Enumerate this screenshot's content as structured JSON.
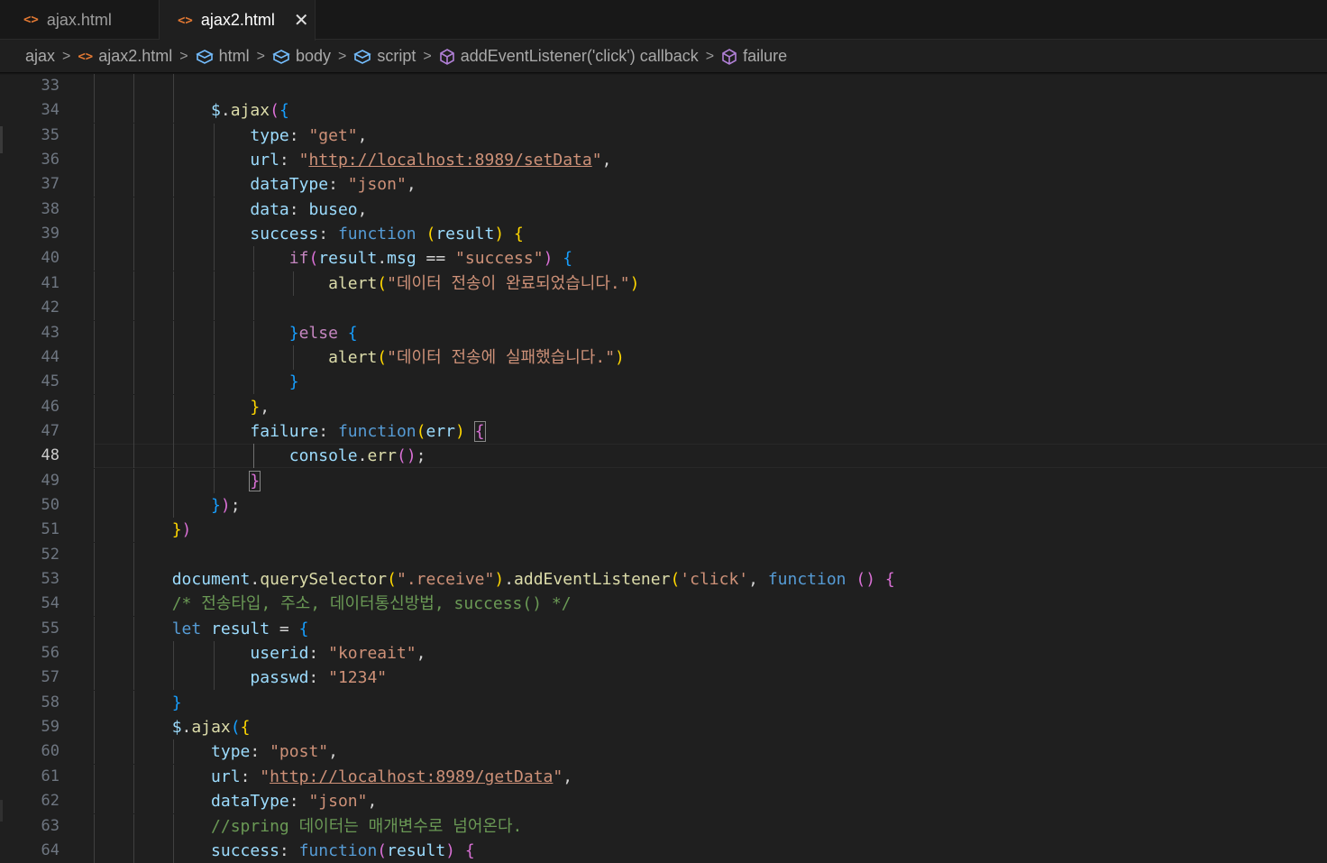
{
  "tabs": [
    {
      "label": "ajax.html",
      "icon": "html-file-icon",
      "active": false
    },
    {
      "label": "ajax2.html",
      "icon": "html-file-icon",
      "active": true
    }
  ],
  "breadcrumbs": [
    {
      "label": "ajax",
      "icon": ""
    },
    {
      "label": "ajax2.html",
      "icon": "html-file-icon"
    },
    {
      "label": "html",
      "icon": "element-icon"
    },
    {
      "label": "body",
      "icon": "element-icon"
    },
    {
      "label": "script",
      "icon": "element-icon"
    },
    {
      "label": "addEventListener('click') callback",
      "icon": "method-icon"
    },
    {
      "label": "failure",
      "icon": "method-icon"
    }
  ],
  "editor": {
    "current_line": "48",
    "lines": [
      {
        "n": "33",
        "tokens": []
      },
      {
        "n": "34",
        "tokens": [
          [
            "            ",
            "plain"
          ],
          [
            "$",
            "var"
          ],
          [
            ".",
            "plain"
          ],
          [
            "ajax",
            "func"
          ],
          [
            "(",
            "b2"
          ],
          [
            "{",
            "b3"
          ]
        ]
      },
      {
        "n": "35",
        "tokens": [
          [
            "                ",
            "plain"
          ],
          [
            "type",
            "var"
          ],
          [
            ": ",
            "plain"
          ],
          [
            "\"get\"",
            "str"
          ],
          [
            ",",
            "plain"
          ]
        ]
      },
      {
        "n": "36",
        "tokens": [
          [
            "                ",
            "plain"
          ],
          [
            "url",
            "var"
          ],
          [
            ": ",
            "plain"
          ],
          [
            "\"",
            "str"
          ],
          [
            "http://localhost:8989/setData",
            "url"
          ],
          [
            "\"",
            "str"
          ],
          [
            ",",
            "plain"
          ]
        ]
      },
      {
        "n": "37",
        "tokens": [
          [
            "                ",
            "plain"
          ],
          [
            "dataType",
            "var"
          ],
          [
            ": ",
            "plain"
          ],
          [
            "\"json\"",
            "str"
          ],
          [
            ",",
            "plain"
          ]
        ]
      },
      {
        "n": "38",
        "tokens": [
          [
            "                ",
            "plain"
          ],
          [
            "data",
            "var"
          ],
          [
            ": ",
            "plain"
          ],
          [
            "buseo",
            "var"
          ],
          [
            ",",
            "plain"
          ]
        ]
      },
      {
        "n": "39",
        "tokens": [
          [
            "                ",
            "plain"
          ],
          [
            "success",
            "var"
          ],
          [
            ": ",
            "plain"
          ],
          [
            "function",
            "kw"
          ],
          [
            " ",
            "plain"
          ],
          [
            "(",
            "b1"
          ],
          [
            "result",
            "var"
          ],
          [
            ")",
            "b1"
          ],
          [
            " ",
            "plain"
          ],
          [
            "{",
            "b1"
          ]
        ]
      },
      {
        "n": "40",
        "tokens": [
          [
            "                    ",
            "plain"
          ],
          [
            "if",
            "ctl"
          ],
          [
            "(",
            "b2"
          ],
          [
            "result",
            "var"
          ],
          [
            ".",
            "plain"
          ],
          [
            "msg",
            "var"
          ],
          [
            " == ",
            "plain"
          ],
          [
            "\"success\"",
            "str"
          ],
          [
            ")",
            "b2"
          ],
          [
            " ",
            "plain"
          ],
          [
            "{",
            "b3"
          ]
        ]
      },
      {
        "n": "41",
        "tokens": [
          [
            "                        ",
            "plain"
          ],
          [
            "alert",
            "func"
          ],
          [
            "(",
            "b1"
          ],
          [
            "\"데이터 전송이 완료되었습니다.\"",
            "str"
          ],
          [
            ")",
            "b1"
          ]
        ]
      },
      {
        "n": "42",
        "tokens": []
      },
      {
        "n": "43",
        "tokens": [
          [
            "                    ",
            "plain"
          ],
          [
            "}",
            "b3"
          ],
          [
            "else",
            "ctl"
          ],
          [
            " ",
            "plain"
          ],
          [
            "{",
            "b3"
          ]
        ]
      },
      {
        "n": "44",
        "tokens": [
          [
            "                        ",
            "plain"
          ],
          [
            "alert",
            "func"
          ],
          [
            "(",
            "b1"
          ],
          [
            "\"데이터 전송에 실패했습니다.\"",
            "str"
          ],
          [
            ")",
            "b1"
          ]
        ]
      },
      {
        "n": "45",
        "tokens": [
          [
            "                    ",
            "plain"
          ],
          [
            "}",
            "b3"
          ]
        ]
      },
      {
        "n": "46",
        "tokens": [
          [
            "                ",
            "plain"
          ],
          [
            "}",
            "b1"
          ],
          [
            ",",
            "plain"
          ]
        ]
      },
      {
        "n": "47",
        "tokens": [
          [
            "                ",
            "plain"
          ],
          [
            "failure",
            "var"
          ],
          [
            ": ",
            "plain"
          ],
          [
            "function",
            "kw"
          ],
          [
            "(",
            "b1"
          ],
          [
            "err",
            "var"
          ],
          [
            ")",
            "b1"
          ],
          [
            " ",
            "plain"
          ],
          [
            "{",
            "hl"
          ]
        ]
      },
      {
        "n": "48",
        "tokens": [
          [
            "                    ",
            "plain"
          ],
          [
            "console",
            "var"
          ],
          [
            ".",
            "plain"
          ],
          [
            "err",
            "func"
          ],
          [
            "(",
            "b2"
          ],
          [
            ")",
            "b2"
          ],
          [
            ";",
            "plain"
          ]
        ]
      },
      {
        "n": "49",
        "tokens": [
          [
            "                ",
            "plain"
          ],
          [
            "}",
            "hl"
          ]
        ]
      },
      {
        "n": "50",
        "tokens": [
          [
            "            ",
            "plain"
          ],
          [
            "}",
            "b3"
          ],
          [
            ")",
            "b2"
          ],
          [
            ";",
            "plain"
          ]
        ]
      },
      {
        "n": "51",
        "tokens": [
          [
            "        ",
            "plain"
          ],
          [
            "}",
            "b1"
          ],
          [
            ")",
            "b2"
          ]
        ]
      },
      {
        "n": "52",
        "tokens": []
      },
      {
        "n": "53",
        "tokens": [
          [
            "        ",
            "plain"
          ],
          [
            "document",
            "var"
          ],
          [
            ".",
            "plain"
          ],
          [
            "querySelector",
            "func"
          ],
          [
            "(",
            "b1"
          ],
          [
            "\".receive\"",
            "str"
          ],
          [
            ")",
            "b1"
          ],
          [
            ".",
            "plain"
          ],
          [
            "addEventListener",
            "func"
          ],
          [
            "(",
            "b1"
          ],
          [
            "'click'",
            "str"
          ],
          [
            ", ",
            "plain"
          ],
          [
            "function",
            "kw"
          ],
          [
            " ",
            "plain"
          ],
          [
            "()",
            "b2"
          ],
          [
            " ",
            "plain"
          ],
          [
            "{",
            "b2"
          ]
        ]
      },
      {
        "n": "54",
        "tokens": [
          [
            "        ",
            "plain"
          ],
          [
            "/* 전송타입, 주소, 데이터통신방법, success() */",
            "com"
          ]
        ]
      },
      {
        "n": "55",
        "tokens": [
          [
            "        ",
            "plain"
          ],
          [
            "let",
            "kw"
          ],
          [
            " ",
            "plain"
          ],
          [
            "result",
            "var"
          ],
          [
            " = ",
            "plain"
          ],
          [
            "{",
            "b3"
          ]
        ]
      },
      {
        "n": "56",
        "tokens": [
          [
            "                ",
            "plain"
          ],
          [
            "userid",
            "var"
          ],
          [
            ": ",
            "plain"
          ],
          [
            "\"koreait\"",
            "str"
          ],
          [
            ",",
            "plain"
          ]
        ]
      },
      {
        "n": "57",
        "tokens": [
          [
            "                ",
            "plain"
          ],
          [
            "passwd",
            "var"
          ],
          [
            ": ",
            "plain"
          ],
          [
            "\"1234\"",
            "str"
          ]
        ]
      },
      {
        "n": "58",
        "tokens": [
          [
            "        ",
            "plain"
          ],
          [
            "}",
            "b3"
          ]
        ]
      },
      {
        "n": "59",
        "tokens": [
          [
            "        ",
            "plain"
          ],
          [
            "$",
            "var"
          ],
          [
            ".",
            "plain"
          ],
          [
            "ajax",
            "func"
          ],
          [
            "(",
            "b3"
          ],
          [
            "{",
            "b1"
          ]
        ]
      },
      {
        "n": "60",
        "tokens": [
          [
            "            ",
            "plain"
          ],
          [
            "type",
            "var"
          ],
          [
            ": ",
            "plain"
          ],
          [
            "\"post\"",
            "str"
          ],
          [
            ",",
            "plain"
          ]
        ]
      },
      {
        "n": "61",
        "tokens": [
          [
            "            ",
            "plain"
          ],
          [
            "url",
            "var"
          ],
          [
            ": ",
            "plain"
          ],
          [
            "\"",
            "str"
          ],
          [
            "http://localhost:8989/getData",
            "url"
          ],
          [
            "\"",
            "str"
          ],
          [
            ",",
            "plain"
          ]
        ]
      },
      {
        "n": "62",
        "tokens": [
          [
            "            ",
            "plain"
          ],
          [
            "dataType",
            "var"
          ],
          [
            ": ",
            "plain"
          ],
          [
            "\"json\"",
            "str"
          ],
          [
            ",",
            "plain"
          ]
        ]
      },
      {
        "n": "63",
        "tokens": [
          [
            "            ",
            "plain"
          ],
          [
            "//spring 데이터는 매개변수로 넘어온다.",
            "com"
          ]
        ]
      },
      {
        "n": "64",
        "tokens": [
          [
            "            ",
            "plain"
          ],
          [
            "success",
            "var"
          ],
          [
            ": ",
            "plain"
          ],
          [
            "function",
            "kw"
          ],
          [
            "(",
            "b2"
          ],
          [
            "result",
            "var"
          ],
          [
            ")",
            "b2"
          ],
          [
            " ",
            "plain"
          ],
          [
            "{",
            "b2"
          ]
        ]
      }
    ]
  }
}
